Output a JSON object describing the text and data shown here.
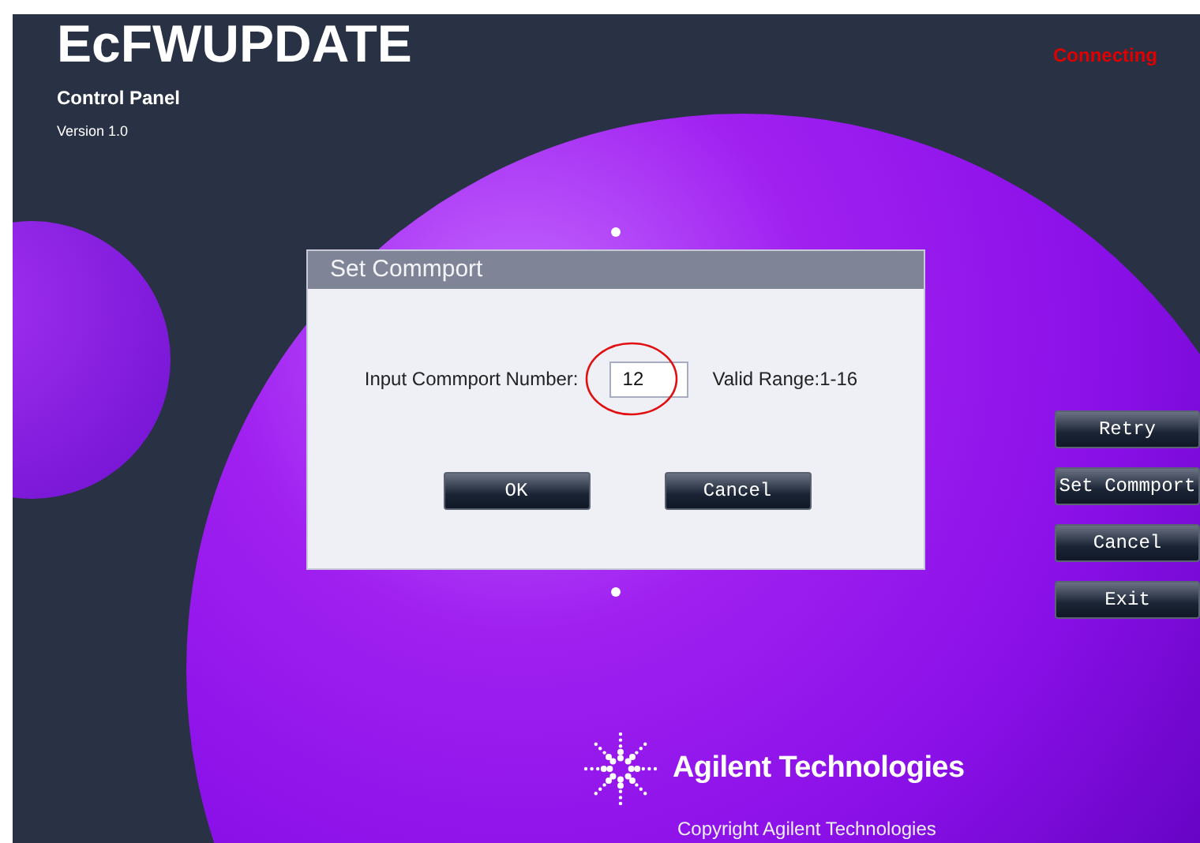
{
  "app": {
    "title": "EcFWUPDATE",
    "subtitle": "Control Panel",
    "version": "Version 1.0",
    "status": "Connecting"
  },
  "dialog": {
    "title": "Set Commport",
    "label": "Input Commport Number:",
    "value": "12",
    "range": "Valid Range:1-16",
    "highlighted": true,
    "buttons": [
      "OK",
      "Cancel"
    ]
  },
  "side_buttons": [
    "Retry",
    "Set Commport",
    "Cancel",
    "Exit"
  ],
  "footer": {
    "brand": "Agilent Technologies",
    "copyright": "Copyright Agilent Technologies"
  }
}
